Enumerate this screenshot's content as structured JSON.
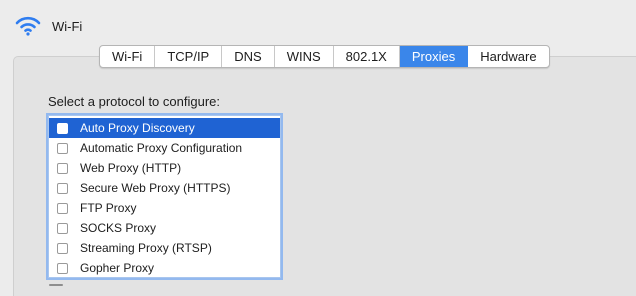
{
  "header": {
    "title": "Wi-Fi",
    "icon": "wifi-icon",
    "icon_color": "#2f7df0"
  },
  "tabs": [
    {
      "label": "Wi-Fi",
      "active": false
    },
    {
      "label": "TCP/IP",
      "active": false
    },
    {
      "label": "DNS",
      "active": false
    },
    {
      "label": "WINS",
      "active": false
    },
    {
      "label": "802.1X",
      "active": false
    },
    {
      "label": "Proxies",
      "active": true
    },
    {
      "label": "Hardware",
      "active": false
    }
  ],
  "proxies": {
    "prompt": "Select a protocol to configure:",
    "protocols": [
      {
        "label": "Auto Proxy Discovery",
        "checked": false,
        "selected": true
      },
      {
        "label": "Automatic Proxy Configuration",
        "checked": false,
        "selected": false
      },
      {
        "label": "Web Proxy (HTTP)",
        "checked": false,
        "selected": false
      },
      {
        "label": "Secure Web Proxy (HTTPS)",
        "checked": false,
        "selected": false
      },
      {
        "label": "FTP Proxy",
        "checked": false,
        "selected": false
      },
      {
        "label": "SOCKS Proxy",
        "checked": false,
        "selected": false
      },
      {
        "label": "Streaming Proxy (RTSP)",
        "checked": false,
        "selected": false
      },
      {
        "label": "Gopher Proxy",
        "checked": false,
        "selected": false
      }
    ]
  },
  "colors": {
    "accent": "#3a86ea",
    "selection": "#1f63d3",
    "focus_ring": "#93b9ef"
  }
}
